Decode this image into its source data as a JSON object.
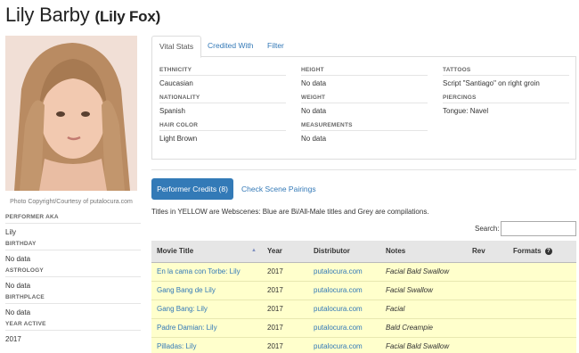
{
  "header": {
    "name": "Lily Barby",
    "aka": "(Lily Fox)"
  },
  "photo": {
    "caption": "Photo Copyright/Courtesy of putalocura.com"
  },
  "sidebar": [
    {
      "label": "PERFORMER AKA",
      "value": "Lily"
    },
    {
      "label": "BIRTHDAY",
      "value": "No data"
    },
    {
      "label": "ASTROLOGY",
      "value": "No data"
    },
    {
      "label": "BIRTHPLACE",
      "value": "No data"
    },
    {
      "label": "YEAR ACTIVE",
      "value": "2017"
    }
  ],
  "tabs": [
    "Vital Stats",
    "Credited With",
    "Filter"
  ],
  "vital_stats": {
    "ethnicity": {
      "label": "ETHNICITY",
      "value": "Caucasian"
    },
    "nationality": {
      "label": "NATIONALITY",
      "value": "Spanish"
    },
    "hair_color": {
      "label": "HAIR COLOR",
      "value": "Light Brown"
    },
    "height": {
      "label": "HEIGHT",
      "value": "No data"
    },
    "weight": {
      "label": "WEIGHT",
      "value": "No data"
    },
    "measurements": {
      "label": "MEASUREMENTS",
      "value": "No data"
    },
    "tattoos": {
      "label": "TATTOOS",
      "value": "Script \"Santiago\" on right groin"
    },
    "piercings": {
      "label": "PIERCINGS",
      "value": "Tongue: Navel"
    }
  },
  "credits": {
    "button_label": "Performer Credits (8)",
    "pairings_label": "Check Scene Pairings",
    "legend": "Titles in YELLOW are Webscenes: Blue are Bi/All-Male titles and Grey are compilations.",
    "search_label": "Search:",
    "search_value": "",
    "columns": [
      "Movie Title",
      "Year",
      "Distributor",
      "Notes",
      "Rev",
      "Formats"
    ],
    "rows": [
      {
        "title": "En la cama con Torbe: Lily",
        "year": "2017",
        "distributor": "putalocura.com",
        "notes": "Facial Bald Swallow",
        "rev": "",
        "formats": ""
      },
      {
        "title": "Gang Bang de Lily",
        "year": "2017",
        "distributor": "putalocura.com",
        "notes": "Facial Swallow",
        "rev": "",
        "formats": ""
      },
      {
        "title": "Gang Bang: Lily",
        "year": "2017",
        "distributor": "putalocura.com",
        "notes": "Facial",
        "rev": "",
        "formats": ""
      },
      {
        "title": "Padre Damian: Lily",
        "year": "2017",
        "distributor": "putalocura.com",
        "notes": "Bald Creampie",
        "rev": "",
        "formats": ""
      },
      {
        "title": "Pilladas: Lily",
        "year": "2017",
        "distributor": "putalocura.com",
        "notes": "Facial Bald Swallow",
        "rev": "",
        "formats": ""
      }
    ]
  },
  "colors": {
    "link": "#3379b7",
    "primary": "#337ab7",
    "webscene_row": "#ffffcc",
    "header_bg": "#e6e6e6"
  },
  "icons": {
    "sort": "sort-asc-icon",
    "help": "help-icon"
  }
}
